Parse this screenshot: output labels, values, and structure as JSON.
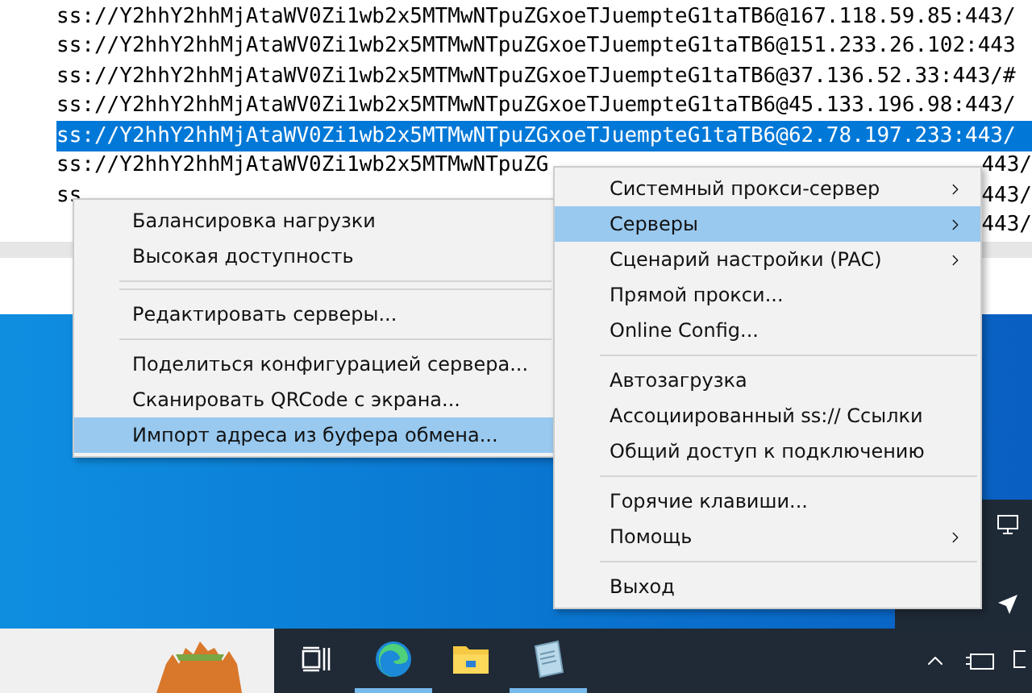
{
  "text_lines": [
    {
      "text": "ss://Y2hhY2hhMjAtaWV0Zi1wb2x5MTMwNTpuZGxoeTJuempteG1taTB6@167.118.59.85:443/",
      "selected": false
    },
    {
      "text": "ss://Y2hhY2hhMjAtaWV0Zi1wb2x5MTMwNTpuZGxoeTJuempteG1taTB6@151.233.26.102:443",
      "selected": false
    },
    {
      "text": "ss://Y2hhY2hhMjAtaWV0Zi1wb2x5MTMwNTpuZGxoeTJuempteG1taTB6@37.136.52.33:443/#",
      "selected": false
    },
    {
      "text": "ss://Y2hhY2hhMjAtaWV0Zi1wb2x5MTMwNTpuZGxoeTJuempteG1taTB6@45.133.196.98:443/",
      "selected": false
    },
    {
      "text": "ss://Y2hhY2hhMjAtaWV0Zi1wb2x5MTMwNTpuZGxoeTJuempteG1taTB6@62.78.197.233:443/",
      "selected": true
    },
    {
      "text": "ss://Y2hhY2hhMjAtaWV0Zi1wb2x5MTMwNTpuZG",
      "tail": "443/",
      "selected": false
    },
    {
      "text": "ss",
      "tail": "443/",
      "selected": false
    },
    {
      "tail": "443/",
      "selected": false
    }
  ],
  "servers_submenu": [
    {
      "kind": "item",
      "label": "Балансировка нагрузки",
      "selected": false
    },
    {
      "kind": "item",
      "label": "Высокая доступность",
      "selected": false
    },
    {
      "kind": "separator"
    },
    {
      "kind": "separator"
    },
    {
      "kind": "item",
      "label": "Редактировать серверы...",
      "selected": false
    },
    {
      "kind": "separator"
    },
    {
      "kind": "item",
      "label": "Поделиться конфигурацией сервера...",
      "selected": false
    },
    {
      "kind": "item",
      "label": "Сканировать QRCode с экрана...",
      "selected": false
    },
    {
      "kind": "item",
      "label": "Импорт адреса из буфера обмена...",
      "selected": true
    }
  ],
  "context_menu": [
    {
      "kind": "item",
      "label": "Системный прокси-сервер",
      "submenu": true,
      "selected": false
    },
    {
      "kind": "item",
      "label": "Серверы",
      "submenu": true,
      "selected": true
    },
    {
      "kind": "item",
      "label": "Сценарий настройки (PAC)",
      "submenu": true,
      "selected": false
    },
    {
      "kind": "item",
      "label": "Прямой прокси...",
      "submenu": false,
      "selected": false
    },
    {
      "kind": "item",
      "label": "Online Config...",
      "submenu": false,
      "selected": false
    },
    {
      "kind": "separator"
    },
    {
      "kind": "item",
      "label": "Автозагрузка",
      "submenu": false,
      "selected": false
    },
    {
      "kind": "item",
      "label": "Ассоциированный ss:// Ссылки",
      "submenu": false,
      "selected": false
    },
    {
      "kind": "item",
      "label": "Общий доступ к подключению",
      "submenu": false,
      "selected": false
    },
    {
      "kind": "separator"
    },
    {
      "kind": "item",
      "label": "Горячие клавиши...",
      "submenu": false,
      "selected": false
    },
    {
      "kind": "item",
      "label": "Помощь",
      "submenu": true,
      "selected": false
    },
    {
      "kind": "separator"
    },
    {
      "kind": "item",
      "label": "Выход",
      "submenu": false,
      "selected": false
    }
  ],
  "taskbar": [
    {
      "kind": "task-view",
      "active": false
    },
    {
      "kind": "browser",
      "active": true
    },
    {
      "kind": "folder",
      "active": false
    },
    {
      "kind": "notepad",
      "active": true
    }
  ]
}
